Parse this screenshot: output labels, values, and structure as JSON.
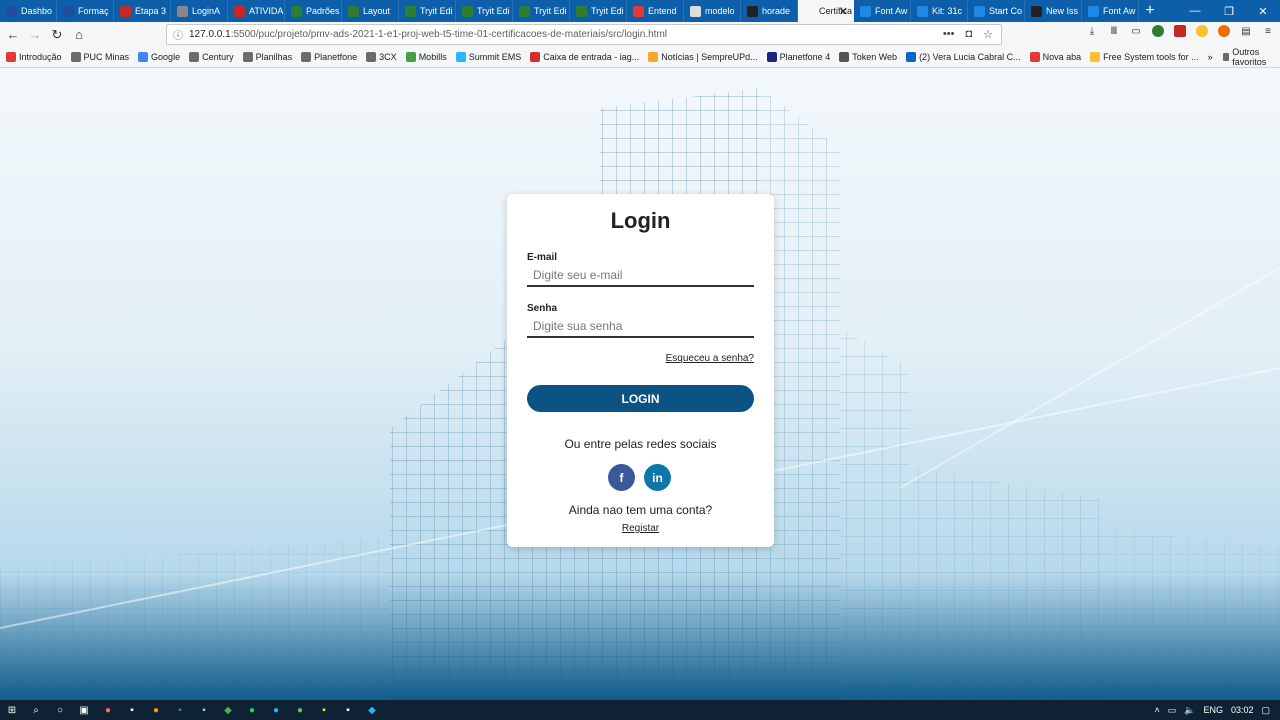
{
  "browser": {
    "tabs": [
      {
        "label": "Dashbo",
        "fav_color": "#1f4e9e"
      },
      {
        "label": "Formaç",
        "fav_color": "#1f4e9e"
      },
      {
        "label": "Etapa 3",
        "fav_color": "#c62828"
      },
      {
        "label": "LoginA",
        "fav_color": "#888888"
      },
      {
        "label": "ATIVIDA",
        "fav_color": "#c62828"
      },
      {
        "label": "Padrões",
        "fav_color": "#2e7d32"
      },
      {
        "label": "Layout",
        "fav_color": "#2e7d32"
      },
      {
        "label": "Tryit Edi",
        "fav_color": "#2e7d32"
      },
      {
        "label": "Tryit Edi",
        "fav_color": "#2e7d32"
      },
      {
        "label": "Tryit Edi",
        "fav_color": "#2e7d32"
      },
      {
        "label": "Tryit Edi",
        "fav_color": "#2e7d32"
      },
      {
        "label": "Entend",
        "fav_color": "#e53935"
      },
      {
        "label": "modelo",
        "fav_color": "#dddddd"
      },
      {
        "label": "horade",
        "fav_color": "#222222"
      },
      {
        "label": "Certifica",
        "fav_color": "#f5f6f7",
        "active": true
      },
      {
        "label": "Font Aw",
        "fav_color": "#1e88e5"
      },
      {
        "label": "Kit: 31c",
        "fav_color": "#1e88e5"
      },
      {
        "label": "Start Co",
        "fav_color": "#1e88e5"
      },
      {
        "label": "New Iss",
        "fav_color": "#222222"
      },
      {
        "label": "Font Aw",
        "fav_color": "#1e88e5"
      }
    ],
    "url": {
      "host": "127.0.0.1",
      "path": ":5500/puc/projeto/pmv-ads-2021-1-e1-proj-web-t5-time-01-certificacoes-de-materiais/src/login.html"
    },
    "bookmarks": [
      {
        "label": "Introdução",
        "color": "#e53935"
      },
      {
        "label": "PUC Minas",
        "color": "#6b6b6b"
      },
      {
        "label": "Google",
        "color": "#4285f4"
      },
      {
        "label": "Century",
        "color": "#6b6b6b"
      },
      {
        "label": "Planilhas",
        "color": "#6b6b6b"
      },
      {
        "label": "Planetfone",
        "color": "#6b6b6b"
      },
      {
        "label": "3CX",
        "color": "#6b6b6b"
      },
      {
        "label": "Mobills",
        "color": "#43a047"
      },
      {
        "label": "Summit EMS",
        "color": "#29b6f6"
      },
      {
        "label": "Caixa de entrada - iag...",
        "color": "#d32f2f"
      },
      {
        "label": "Notícias | SempreUPd...",
        "color": "#f9a825"
      },
      {
        "label": "Planetfone 4",
        "color": "#1a237e"
      },
      {
        "label": "Token Web",
        "color": "#555555"
      },
      {
        "label": "(2) Vera Lucia Cabral C...",
        "color": "#0a66c2"
      },
      {
        "label": "Nova aba",
        "color": "#e53935"
      },
      {
        "label": "Free System tools for ...",
        "color": "#fbc02d"
      }
    ],
    "bookmarks_other": "Outros favoritos"
  },
  "login": {
    "title": "Login",
    "email_label": "E-mail",
    "email_placeholder": "Digite seu e-mail",
    "password_label": "Senha",
    "password_placeholder": "Digite sua senha",
    "forgot": "Esqueceu a senha?",
    "button": "LOGIN",
    "social_text": "Ou entre pelas redes sociais",
    "facebook": "f",
    "linkedin": "in",
    "no_account": "Ainda nao tem uma conta?",
    "register": "Registar"
  },
  "taskbar": {
    "lang": "ENG",
    "time": "03:02"
  }
}
